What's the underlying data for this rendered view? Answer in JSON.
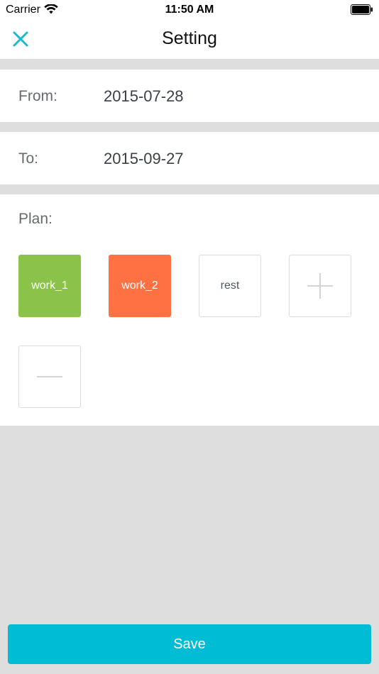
{
  "status_bar": {
    "carrier": "Carrier",
    "time": "11:50 AM",
    "wifi_icon": "wifi-icon",
    "battery_icon": "battery-icon"
  },
  "nav": {
    "title": "Setting",
    "close_icon": "close-icon",
    "accent_color": "#1bb8ce"
  },
  "form": {
    "from_label": "From:",
    "from_value": "2015-07-28",
    "to_label": "To:",
    "to_value": "2015-09-27",
    "plan_label": "Plan:"
  },
  "plan": {
    "tiles": [
      {
        "label": "work_1",
        "color": "#8bc34a"
      },
      {
        "label": "work_2",
        "color": "#ff7043"
      },
      {
        "label": "rest",
        "color": "#ffffff"
      }
    ],
    "add_icon": "plus-icon",
    "remove_icon": "minus-icon"
  },
  "footer": {
    "save_label": "Save",
    "save_color": "#00bcd4"
  }
}
